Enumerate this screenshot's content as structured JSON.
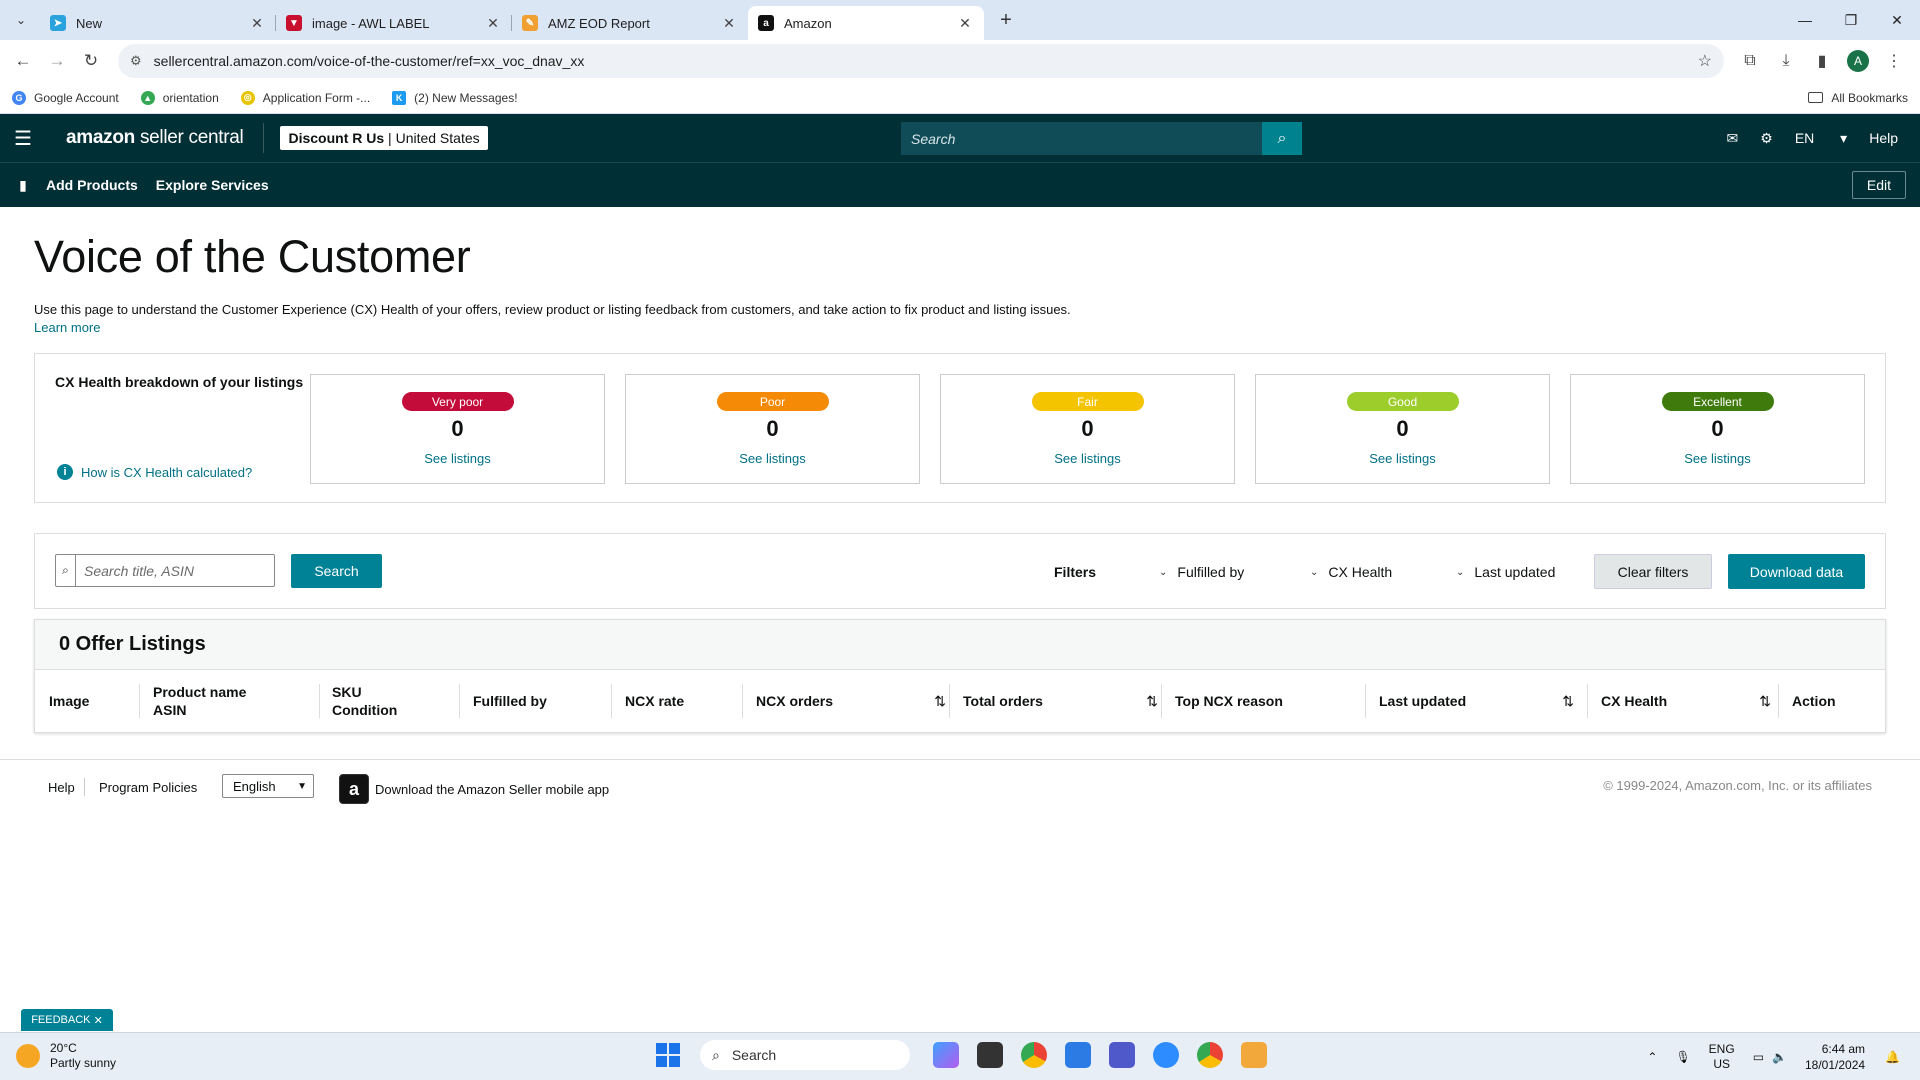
{
  "browser": {
    "tabs": [
      {
        "title": "New",
        "favicon_color": "#2aa2de",
        "active": false
      },
      {
        "title": "image - AWL LABEL",
        "favicon_color": "#c8102e",
        "active": false
      },
      {
        "title": "AMZ EOD Report",
        "favicon_color": "#f0a030",
        "active": false
      },
      {
        "title": "Amazon",
        "favicon_color": "#111111",
        "active": true
      }
    ],
    "url": "sellercentral.amazon.com/voice-of-the-customer/ref=xx_voc_dnav_xx",
    "profile_initial": "A",
    "bookmarks": [
      {
        "label": "Google Account",
        "color": "#4285f4",
        "glyph": "G"
      },
      {
        "label": "orientation",
        "color": "#34a853",
        "glyph": "▲"
      },
      {
        "label": "Application Form -...",
        "color": "#e8c400",
        "glyph": "◎"
      },
      {
        "label": "(2) New Messages!",
        "color": "#1d9bf0",
        "glyph": "K"
      }
    ],
    "all_bookmarks": "All Bookmarks"
  },
  "header": {
    "logo_bold": "amazon",
    "logo_rest": "seller central",
    "store_name": "Discount R Us",
    "marketplace": "United States",
    "search_placeholder": "Search",
    "language": "EN",
    "help": "Help",
    "subnav": [
      "Add Products",
      "Explore Services"
    ],
    "edit": "Edit"
  },
  "page": {
    "title": "Voice of the Customer",
    "intro": "Use this page to understand the Customer Experience (CX) Health of your offers, review product or listing feedback from customers, and take action to fix product and listing issues.",
    "learn_more": "Learn more"
  },
  "cx_health": {
    "label": "CX Health breakdown of your listings",
    "how_link": "How is CX Health calculated?",
    "cards": [
      {
        "badge": "Very poor",
        "color": "#c40c3a",
        "count": "0",
        "link": "See listings"
      },
      {
        "badge": "Poor",
        "color": "#f58a07",
        "count": "0",
        "link": "See listings"
      },
      {
        "badge": "Fair",
        "color": "#f5c400",
        "count": "0",
        "link": "See listings"
      },
      {
        "badge": "Good",
        "color": "#9ccd2b",
        "count": "0",
        "link": "See listings"
      },
      {
        "badge": "Excellent",
        "color": "#3f7a0d",
        "count": "0",
        "link": "See listings"
      }
    ]
  },
  "filters": {
    "search_placeholder": "Search title, ASIN",
    "search_button": "Search",
    "label": "Filters",
    "fulfilled_by": "Fulfilled by",
    "cx_health": "CX Health",
    "last_updated": "Last updated",
    "clear": "Clear filters",
    "download": "Download data"
  },
  "listings": {
    "heading": "0 Offer Listings",
    "columns": {
      "image": "Image",
      "product_name": "Product name",
      "asin": "ASIN",
      "sku": "SKU",
      "condition": "Condition",
      "fulfilled_by": "Fulfilled by",
      "ncx_rate": "NCX rate",
      "ncx_orders": "NCX orders",
      "total_orders": "Total orders",
      "top_ncx_reason": "Top NCX reason",
      "last_updated": "Last updated",
      "cx_health": "CX Health",
      "action": "Action"
    }
  },
  "footer": {
    "help": "Help",
    "policies": "Program Policies",
    "language": "English",
    "app_text": "Download the Amazon Seller mobile app",
    "copyright": "© 1999-2024, Amazon.com, Inc. or its affiliates"
  },
  "feedback": "FEEDBACK",
  "taskbar": {
    "temp": "20°C",
    "weather": "Partly sunny",
    "search": "Search",
    "lang_top": "ENG",
    "lang_bottom": "US",
    "time": "6:44 am",
    "date": "18/01/2024"
  }
}
